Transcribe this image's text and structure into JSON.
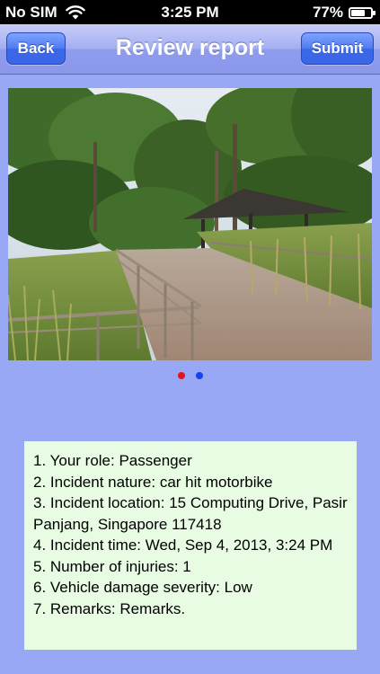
{
  "status_bar": {
    "carrier": "No SIM",
    "time": "3:25 PM",
    "battery": "77%",
    "battery_level": 0.77,
    "wifi_icon": "wifi-icon",
    "battery_icon": "battery-icon"
  },
  "nav": {
    "title": "Review report",
    "back_label": "Back",
    "submit_label": "Submit"
  },
  "colors": {
    "background": "#99a8f5",
    "button": "#3b66e8",
    "panel": "#e8fbe3",
    "dot_active": "#e8121c",
    "dot_inactive": "#1a3ff0"
  },
  "photo": {
    "subject": "photo"
  },
  "page_indicator": {
    "count": 2,
    "active_index": 0
  },
  "report": {
    "lines": [
      "1. Your role: Passenger",
      "2. Incident nature: car hit motorbike",
      "3. Incident location: 15 Computing Drive, Pasir Panjang, Singapore 117418",
      "4. Incident time: Wed, Sep 4, 2013, 3:24 PM",
      "5. Number of injuries: 1",
      "6. Vehicle damage severity: Low",
      "7. Remarks: Remarks."
    ]
  }
}
